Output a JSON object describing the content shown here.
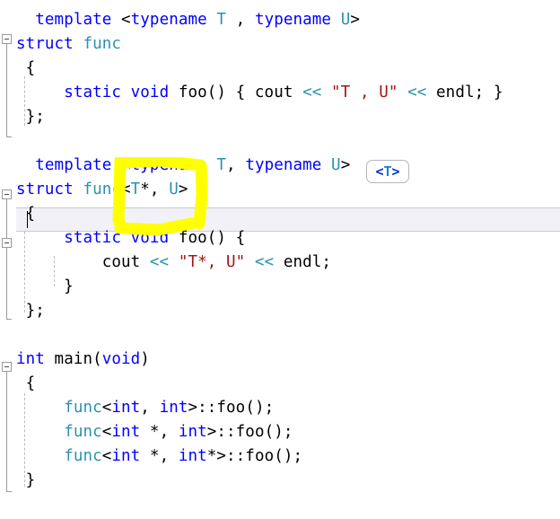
{
  "editor": {
    "language": "C++",
    "background_color": "#ffffff",
    "current_line_color": "#f1f1f7",
    "colors": {
      "keyword": "#0000ff",
      "type": "#2b91af",
      "string": "#a31515",
      "operator": "#2b91af",
      "plain": "#000000",
      "fold_marker": "#9a9a9a",
      "indent_guide": "#bcbcbc",
      "marker_highlight": "#ffff00"
    },
    "caret_visible": true
  },
  "annotation": {
    "marker_color": "#ffff00",
    "marker_shape": "hand-drawn-rectangle",
    "marker_target": "<T*, U>"
  },
  "badge": {
    "label": "<T>",
    "open_angle": "<",
    "type_letter": "T",
    "close_angle": ">"
  },
  "code": {
    "lines": [
      {
        "n": 1,
        "indent": 0,
        "fold": "none",
        "tokens": [
          {
            "t": "  ",
            "c": "pln"
          },
          {
            "t": "template",
            "c": "kw"
          },
          {
            "t": " <",
            "c": "pln"
          },
          {
            "t": "typename",
            "c": "kw"
          },
          {
            "t": " ",
            "c": "pln"
          },
          {
            "t": "T",
            "c": "typ"
          },
          {
            "t": " , ",
            "c": "pln"
          },
          {
            "t": "typename",
            "c": "kw"
          },
          {
            "t": " ",
            "c": "pln"
          },
          {
            "t": "U",
            "c": "typ"
          },
          {
            "t": ">",
            "c": "pln"
          }
        ]
      },
      {
        "n": 2,
        "indent": 0,
        "fold": "open",
        "tokens": [
          {
            "t": "struct",
            "c": "kw"
          },
          {
            "t": " ",
            "c": "pln"
          },
          {
            "t": "func",
            "c": "typ"
          }
        ]
      },
      {
        "n": 3,
        "indent": 0,
        "fold": "none",
        "tokens": [
          {
            "t": " {",
            "c": "pln"
          }
        ]
      },
      {
        "n": 4,
        "indent": 1,
        "fold": "none",
        "tokens": [
          {
            "t": "     ",
            "c": "pln"
          },
          {
            "t": "static",
            "c": "kw"
          },
          {
            "t": " ",
            "c": "pln"
          },
          {
            "t": "void",
            "c": "kw"
          },
          {
            "t": " foo() { cout ",
            "c": "pln"
          },
          {
            "t": "<<",
            "c": "op"
          },
          {
            "t": " ",
            "c": "pln"
          },
          {
            "t": "\"T , U\"",
            "c": "str"
          },
          {
            "t": " ",
            "c": "pln"
          },
          {
            "t": "<<",
            "c": "op"
          },
          {
            "t": " endl; }",
            "c": "pln"
          }
        ]
      },
      {
        "n": 5,
        "indent": 0,
        "fold": "none",
        "tokens": [
          {
            "t": " };",
            "c": "pln"
          }
        ]
      },
      {
        "n": 6,
        "indent": 0,
        "fold": "none",
        "tokens": []
      },
      {
        "n": 7,
        "indent": 0,
        "fold": "none",
        "tokens": [
          {
            "t": "  ",
            "c": "pln"
          },
          {
            "t": "template",
            "c": "kw"
          },
          {
            "t": " <",
            "c": "pln"
          },
          {
            "t": "typename",
            "c": "kw"
          },
          {
            "t": " ",
            "c": "pln"
          },
          {
            "t": "T",
            "c": "typ"
          },
          {
            "t": ", ",
            "c": "pln"
          },
          {
            "t": "typename",
            "c": "kw"
          },
          {
            "t": " ",
            "c": "pln"
          },
          {
            "t": "U",
            "c": "typ"
          },
          {
            "t": ">",
            "c": "pln"
          }
        ]
      },
      {
        "n": 8,
        "indent": 0,
        "fold": "open",
        "tokens": [
          {
            "t": "struct",
            "c": "kw"
          },
          {
            "t": " ",
            "c": "pln"
          },
          {
            "t": "func",
            "c": "typ"
          },
          {
            "t": "<",
            "c": "pln"
          },
          {
            "t": "T",
            "c": "typ"
          },
          {
            "t": "*, ",
            "c": "pln"
          },
          {
            "t": "U",
            "c": "typ"
          },
          {
            "t": ">",
            "c": "pln"
          }
        ]
      },
      {
        "n": 9,
        "indent": 0,
        "fold": "none",
        "current": true,
        "tokens": [
          {
            "t": " {",
            "c": "pln"
          }
        ]
      },
      {
        "n": 10,
        "indent": 1,
        "fold": "open",
        "tokens": [
          {
            "t": "     ",
            "c": "pln"
          },
          {
            "t": "static",
            "c": "kw"
          },
          {
            "t": " ",
            "c": "pln"
          },
          {
            "t": "void",
            "c": "kw"
          },
          {
            "t": " foo() {",
            "c": "pln"
          }
        ]
      },
      {
        "n": 11,
        "indent": 2,
        "fold": "none",
        "tokens": [
          {
            "t": "         cout ",
            "c": "pln"
          },
          {
            "t": "<<",
            "c": "op"
          },
          {
            "t": " ",
            "c": "pln"
          },
          {
            "t": "\"T*, U\"",
            "c": "str"
          },
          {
            "t": " ",
            "c": "pln"
          },
          {
            "t": "<<",
            "c": "op"
          },
          {
            "t": " endl;",
            "c": "pln"
          }
        ]
      },
      {
        "n": 12,
        "indent": 1,
        "fold": "none",
        "tokens": [
          {
            "t": "     }",
            "c": "pln"
          }
        ]
      },
      {
        "n": 13,
        "indent": 0,
        "fold": "none",
        "tokens": [
          {
            "t": " };",
            "c": "pln"
          }
        ]
      },
      {
        "n": 14,
        "indent": 0,
        "fold": "none",
        "tokens": []
      },
      {
        "n": 15,
        "indent": 0,
        "fold": "open",
        "tokens": [
          {
            "t": "int",
            "c": "kw"
          },
          {
            "t": " main(",
            "c": "pln"
          },
          {
            "t": "void",
            "c": "kw"
          },
          {
            "t": ")",
            "c": "pln"
          }
        ]
      },
      {
        "n": 16,
        "indent": 0,
        "fold": "none",
        "tokens": [
          {
            "t": " {",
            "c": "pln"
          }
        ]
      },
      {
        "n": 17,
        "indent": 1,
        "fold": "none",
        "tokens": [
          {
            "t": "     ",
            "c": "pln"
          },
          {
            "t": "func",
            "c": "typ"
          },
          {
            "t": "<",
            "c": "pln"
          },
          {
            "t": "int",
            "c": "kw"
          },
          {
            "t": ", ",
            "c": "pln"
          },
          {
            "t": "int",
            "c": "kw"
          },
          {
            "t": ">::foo();",
            "c": "pln"
          }
        ]
      },
      {
        "n": 18,
        "indent": 1,
        "fold": "none",
        "tokens": [
          {
            "t": "     ",
            "c": "pln"
          },
          {
            "t": "func",
            "c": "typ"
          },
          {
            "t": "<",
            "c": "pln"
          },
          {
            "t": "int",
            "c": "kw"
          },
          {
            "t": " *, ",
            "c": "pln"
          },
          {
            "t": "int",
            "c": "kw"
          },
          {
            "t": ">::foo();",
            "c": "pln"
          }
        ]
      },
      {
        "n": 19,
        "indent": 1,
        "fold": "none",
        "tokens": [
          {
            "t": "     ",
            "c": "pln"
          },
          {
            "t": "func",
            "c": "typ"
          },
          {
            "t": "<",
            "c": "pln"
          },
          {
            "t": "int",
            "c": "kw"
          },
          {
            "t": " *, ",
            "c": "pln"
          },
          {
            "t": "int",
            "c": "kw"
          },
          {
            "t": "*>::foo();",
            "c": "pln"
          }
        ]
      },
      {
        "n": 20,
        "indent": 0,
        "fold": "none",
        "tokens": [
          {
            "t": " }",
            "c": "pln"
          }
        ]
      }
    ]
  }
}
